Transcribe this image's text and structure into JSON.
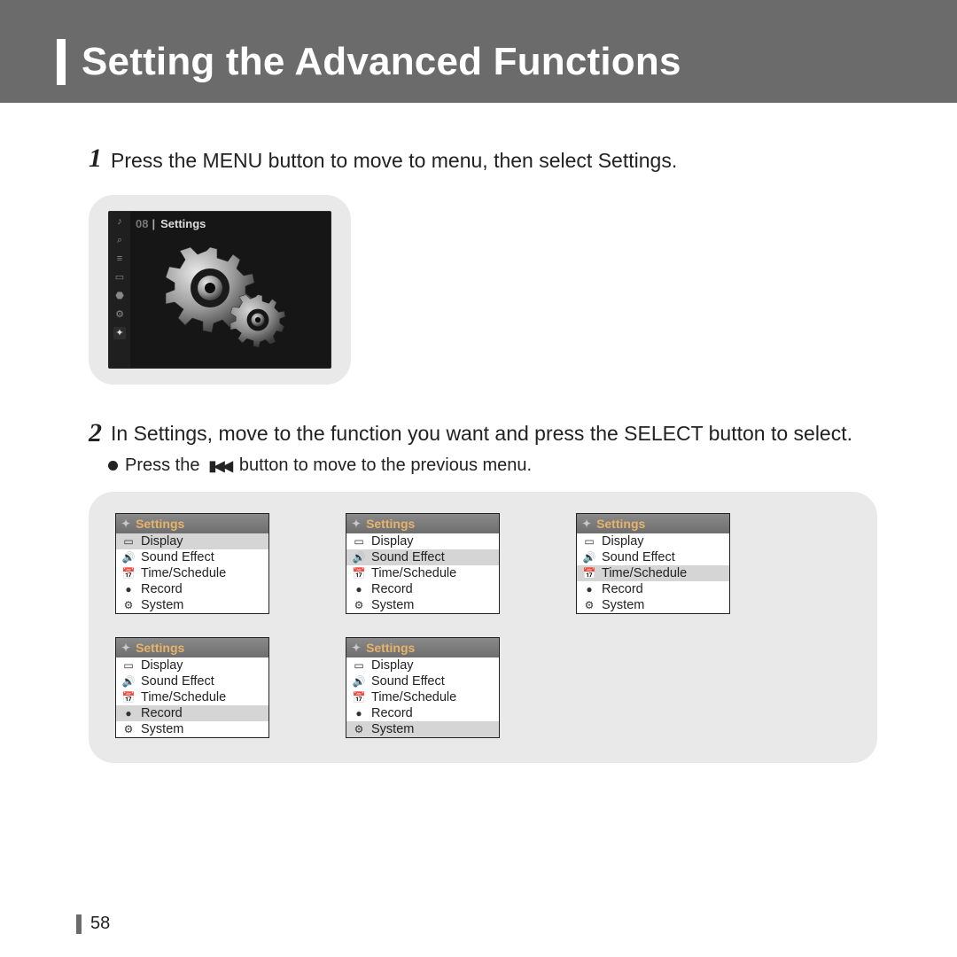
{
  "title": "Setting the Advanced Functions",
  "step1": {
    "num": "1",
    "text": "Press the MENU button to move to menu, then select Settings."
  },
  "device_shot": {
    "header_num": "08",
    "header_sep": "|",
    "header_label": "Settings",
    "sidebar_icons": [
      "♪",
      "⌕",
      "≡",
      "▭",
      "⬣",
      "⚙",
      "✦"
    ]
  },
  "step2": {
    "num": "2",
    "text": "In Settings, move to the function you want and press the SELECT button to select."
  },
  "bullet": {
    "pre": "Press the",
    "post": "button to move to the previous menu."
  },
  "panel_header": "Settings",
  "menu_items": [
    {
      "icon": "▭",
      "label": "Display"
    },
    {
      "icon": "🔊",
      "label": "Sound Effect"
    },
    {
      "icon": "📅",
      "label": "Time/Schedule"
    },
    {
      "icon": "●",
      "label": "Record"
    },
    {
      "icon": "⚙",
      "label": "System"
    }
  ],
  "panels": [
    {
      "selected": 0
    },
    {
      "selected": 1
    },
    {
      "selected": 2
    },
    {
      "selected": 3
    },
    {
      "selected": 4
    }
  ],
  "page_number": "58"
}
